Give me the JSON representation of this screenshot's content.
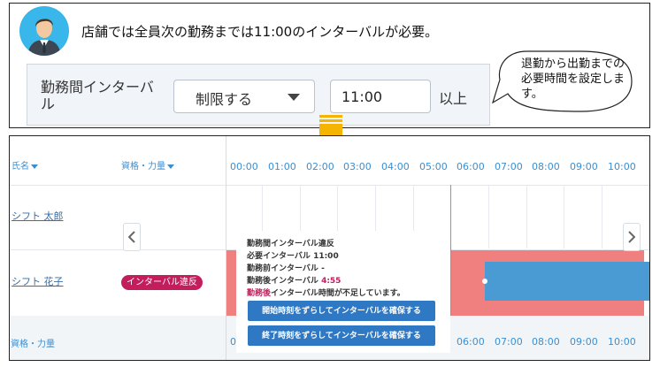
{
  "top": {
    "message": "店舗では全員次の勤務までは11:00のインターバルが必要。",
    "setting_label": "勤務間インターバル",
    "limit_select": "制限する",
    "interval_value": "11:00",
    "suffix": "以上",
    "callout": "退勤から出勤までの必要時間を設定します。"
  },
  "schedule": {
    "col_name": "氏名",
    "col_skill": "資格・力量",
    "hours": [
      "00:00",
      "01:00",
      "02:00",
      "03:00",
      "04:00",
      "05:00",
      "06:00",
      "07:00",
      "08:00",
      "09:00",
      "10:00"
    ],
    "footer_label": "資格・力量",
    "footer_hours": [
      "06:00",
      "07:00",
      "08:00",
      "09:00",
      "10:00"
    ],
    "footer_partial": "0",
    "staff": [
      {
        "name": "シフト 太郎"
      },
      {
        "name": "シフト 花子",
        "badge": "インターバル違反"
      }
    ]
  },
  "tooltip": {
    "title": "勤務間インターバル違反",
    "required_label": "必要インターバル",
    "required_value": "11:00",
    "before_label": "勤務前インターバル",
    "before_value": "-",
    "after_label": "勤務後インターバル",
    "after_value": "4:55",
    "shortage_prefix": "勤務後",
    "shortage_text": "インターバル時間が不足しています。",
    "btn_shift_start": "開始時刻をずらしてインターバルを確保する",
    "btn_shift_end": "終了時刻をずらしてインターバルを確保する"
  },
  "colors": {
    "accent": "#3a8fd3",
    "violation_fill": "#f08080",
    "shift_bar": "#4a9ad3",
    "badge": "#c31d5e",
    "button": "#2f78c4",
    "arrow": "#f5b400"
  }
}
